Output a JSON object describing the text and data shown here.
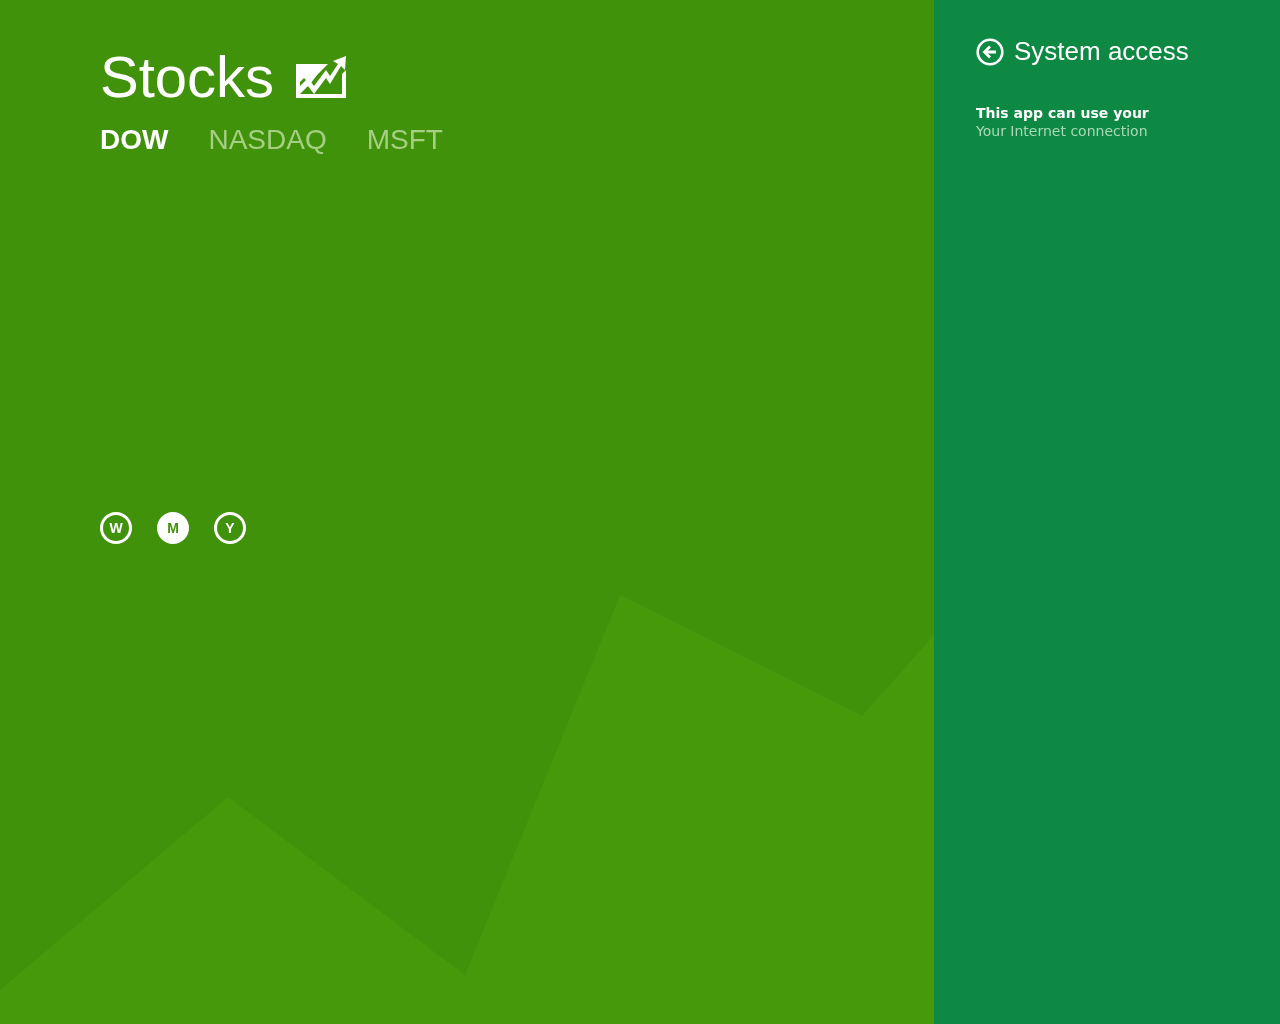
{
  "app": {
    "title": "Stocks"
  },
  "tabs": [
    {
      "label": "DOW",
      "selected": true
    },
    {
      "label": "NASDAQ",
      "selected": false
    },
    {
      "label": "MSFT",
      "selected": false
    }
  ],
  "ranges": [
    {
      "label": "W",
      "selected": false
    },
    {
      "label": "M",
      "selected": true
    },
    {
      "label": "Y",
      "selected": false
    }
  ],
  "settings_panel": {
    "title": "System access",
    "heading": "This app can use your",
    "items": [
      "Your Internet connection"
    ]
  }
}
